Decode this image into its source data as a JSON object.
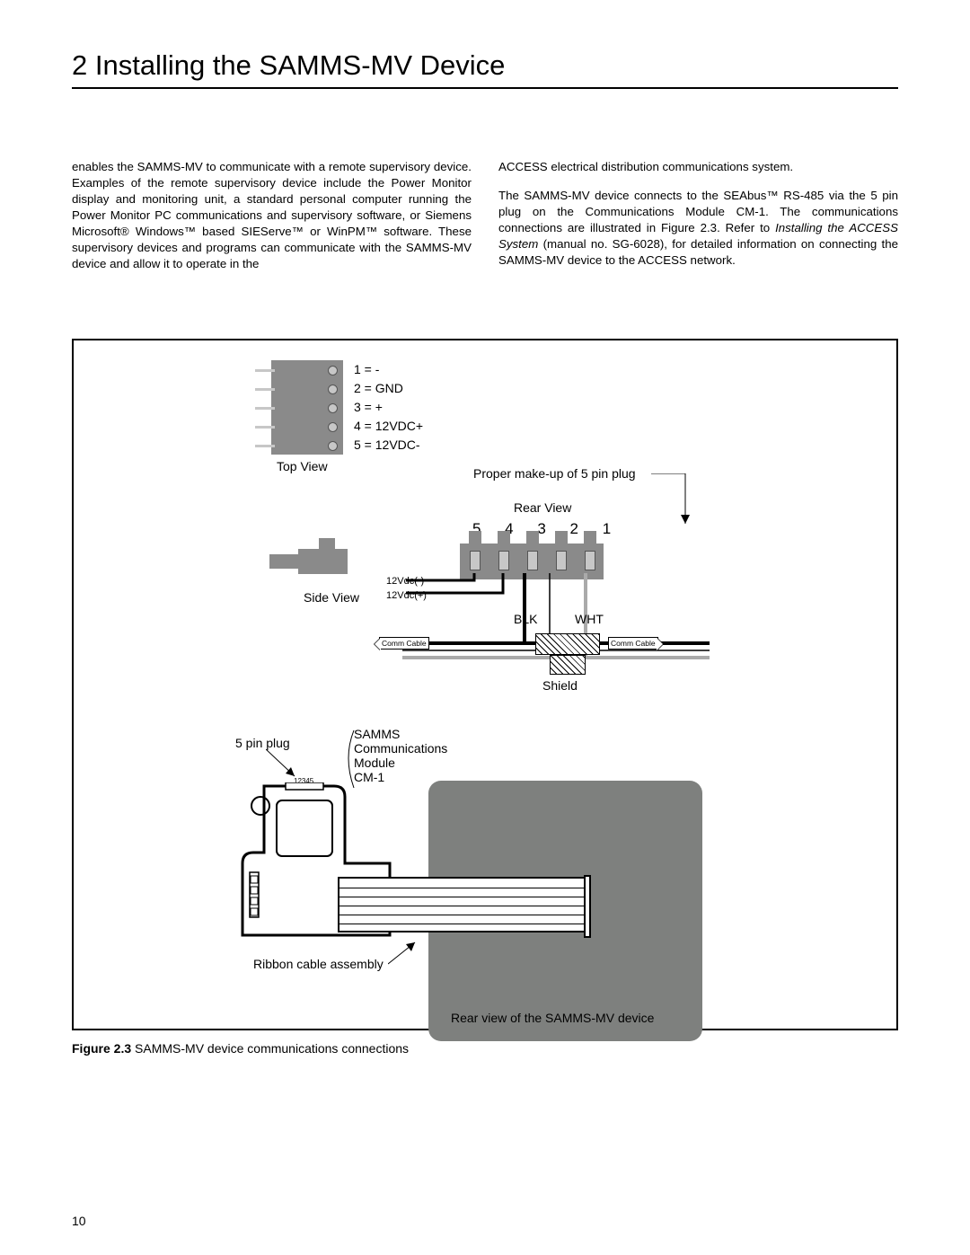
{
  "header": {
    "title": "2 Installing the SAMMS-MV Device"
  },
  "body": {
    "col1_p1": "enables the SAMMS-MV to communicate with a remote supervisory device. Examples of the remote supervisory device include the Power Monitor display and monitoring unit, a standard personal computer running the Power Monitor PC communications and supervisory software, or Siemens Microsoft® Windows™ based SIEServe™ or WinPM™ software. These supervisory devices and programs can communicate with the SAMMS-MV device and allow it to operate in the",
    "col2_p1": "ACCESS electrical distribution communications system.",
    "col2_p2a": "The SAMMS-MV device connects to the SEAbus™ RS-485 via the 5 pin plug on the Communications Module CM-1. The communications connections are illustrated in Figure 2.3. Refer to ",
    "col2_p2_italic": "Installing the ACCESS System",
    "col2_p2b": " (manual no. SG-6028), for detailed information on connecting the SAMMS-MV device to the ACCESS network."
  },
  "figure": {
    "pins": {
      "p1": "1 = -",
      "p2": "2 = GND",
      "p3": "3 = +",
      "p4": "4 = 12VDC+",
      "p5": "5 = 12VDC-"
    },
    "top_view": "Top View",
    "side_view": "Side View",
    "proper_makeup": "Proper make-up of 5 pin plug",
    "rear_view": "Rear View",
    "pin_numbers": "5  4  3  2  1",
    "v12neg": "12Vdc(-)",
    "v12pos": "12Vdc(+)",
    "blk": "BLK",
    "wht": "WHT",
    "shield": "Shield",
    "comm_cable": "Comm Cable",
    "five_pin_plug": "5 pin plug",
    "cm1_label": "SAMMS\nCommunications\nModule\nCM-1",
    "ribbon": "Ribbon cable assembly",
    "rear_device": "Rear view of the SAMMS-MV device",
    "tiny_numbers": "12345"
  },
  "caption": {
    "bold": "Figure 2.3",
    "rest": " SAMMS-MV device communications connections"
  },
  "page_number": "10"
}
